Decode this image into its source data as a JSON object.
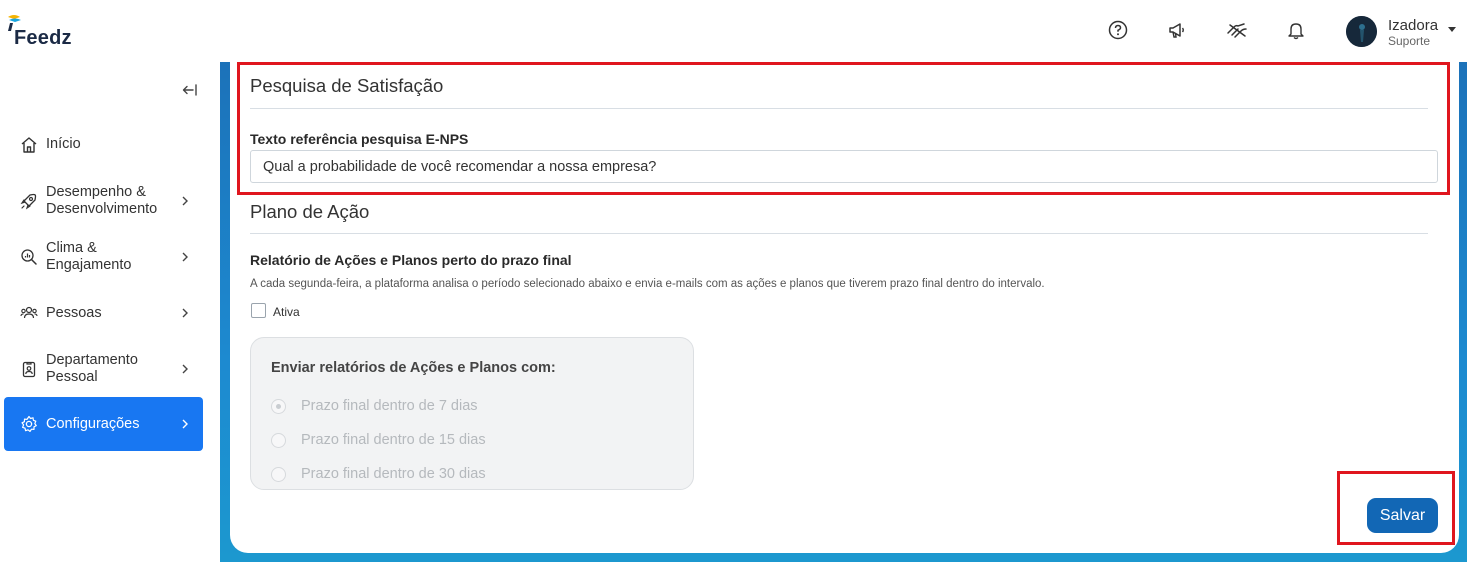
{
  "header": {
    "logo_text": "Feedz",
    "icons": [
      "help-icon",
      "megaphone-icon",
      "hand-icon",
      "bell-icon"
    ],
    "user": {
      "name": "Izadora",
      "role": "Suporte"
    }
  },
  "sidebar": {
    "items": [
      {
        "label": "Início",
        "icon": "home-icon",
        "has_chevron": false
      },
      {
        "label": "Desempenho & Desenvolvimento",
        "line1": "Desempenho &",
        "line2": "Desenvolvimento",
        "icon": "rocket-icon",
        "has_chevron": true
      },
      {
        "label": "Clima & Engajamento",
        "line1": "Clima &",
        "line2": "Engajamento",
        "icon": "search-chart-icon",
        "has_chevron": true
      },
      {
        "label": "Pessoas",
        "icon": "people-icon",
        "has_chevron": true
      },
      {
        "label": "Departamento Pessoal",
        "line1": "Departamento",
        "line2": "Pessoal",
        "icon": "badge-icon",
        "has_chevron": true
      },
      {
        "label": "Configurações",
        "icon": "gear-icon",
        "has_chevron": true,
        "active": true
      }
    ]
  },
  "survey": {
    "title": "Pesquisa de Satisfação",
    "field_label": "Texto referência pesquisa E-NPS",
    "field_value": "Qual a probabilidade de você recomendar a nossa empresa?"
  },
  "action_plan": {
    "title": "Plano de Ação",
    "report_label": "Relatório de Ações e Planos perto do prazo final",
    "description": "A cada segunda-feira, a plataforma analisa o período selecionado abaixo e envia e-mails com as ações e planos que tiverem prazo final dentro do intervalo.",
    "checkbox_label": "Ativa",
    "checkbox_checked": false,
    "options_title": "Enviar relatórios de Ações e Planos com:",
    "options": [
      {
        "label": "Prazo final dentro de 7 dias",
        "selected": true
      },
      {
        "label": "Prazo final dentro de 15 dias",
        "selected": false
      },
      {
        "label": "Prazo final dentro de 30 dias",
        "selected": false
      }
    ]
  },
  "actions": {
    "save_label": "Salvar"
  },
  "colors": {
    "primary": "#1877f2",
    "save_button": "#1267b5",
    "highlight": "#e0161e",
    "frame_gradient_top": "#1c72b9"
  }
}
